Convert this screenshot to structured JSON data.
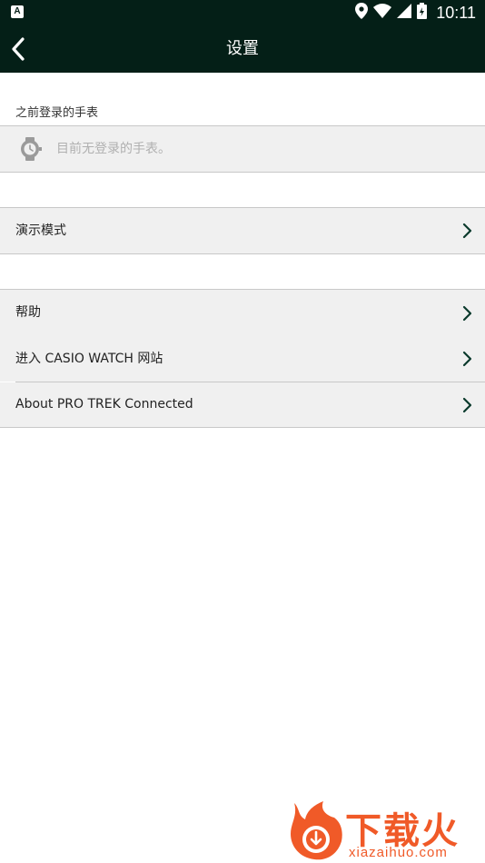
{
  "status_bar": {
    "notification_glyph": "A",
    "time": "10:11",
    "icons": [
      "location-icon",
      "wifi-icon",
      "signal-icon",
      "battery-icon"
    ]
  },
  "toolbar": {
    "title": "设置",
    "back_icon": "back-arrow-icon"
  },
  "previous_watches": {
    "header": "之前登录的手表",
    "empty_text": "目前无登录的手表。",
    "icon": "watch-icon"
  },
  "demo": {
    "label": "演示模式"
  },
  "help_items": [
    {
      "label": "帮助"
    },
    {
      "label": "进入 CASIO WATCH 网站"
    }
  ],
  "about": {
    "label": "About PRO TREK Connected"
  },
  "watermark": {
    "brand": "下载火",
    "url": "xiazaihuo.com"
  },
  "colors": {
    "toolbar_bg": "#041f17",
    "row_bg": "#f0f0f0",
    "chevron": "#0b3a2c",
    "watermark": "#f05a28"
  }
}
